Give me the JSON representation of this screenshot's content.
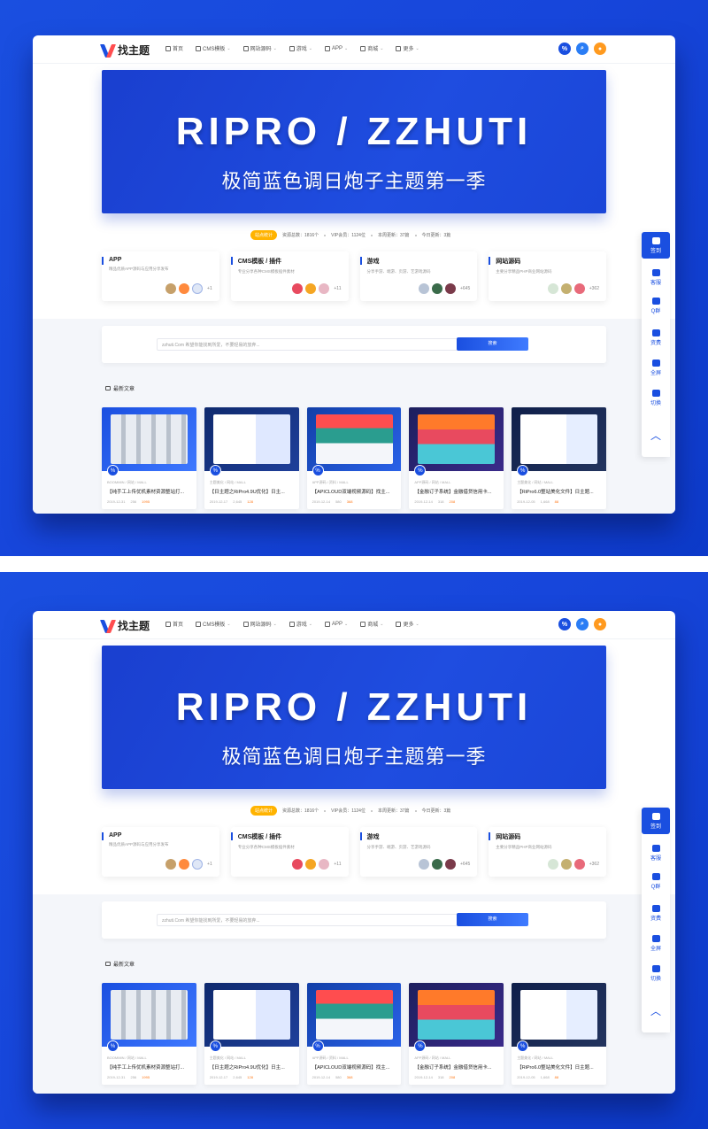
{
  "screens": [
    {
      "nav": {
        "logo": "找主题",
        "menu": [
          "首页",
          "CMS模板",
          "网站源码",
          "游戏",
          "APP",
          "商城",
          "更多"
        ],
        "icons": [
          "percent-icon",
          "search-icon",
          "user-icon"
        ]
      },
      "banner": {
        "title": "RIPRO / ZZHUTI",
        "subtitle": "极简蓝色调日炮子主题第一季"
      },
      "stats": {
        "pill": "站点统计",
        "items": [
          "资源总数：1816个",
          "VIP会员：1124位",
          "本周更新：37篇",
          "今日更新：3篇"
        ]
      },
      "categories": [
        {
          "title": "APP",
          "desc": "精品优质APP源码与应用分享发布",
          "more": "+1"
        },
        {
          "title": "CMS模板 / 插件",
          "desc": "专业分享各种CMS模板插件素材",
          "more": "+11"
        },
        {
          "title": "游戏",
          "desc": "分享手游、端游、页游、艺游戏源码",
          "more": "+645"
        },
        {
          "title": "网站源码",
          "desc": "主要分享精品PHP商业网站源码",
          "more": "+362"
        }
      ],
      "search": {
        "placeholder": "zzhuti.Com 希望你能找到所爱，不要轻易的放弃...",
        "button": "搜索"
      },
      "latest_title": "最新文章",
      "posts": [
        {
          "meta": "BOOMMIN / 网站 / MALL",
          "title": "【纯手工上传优机素材资源整站打...",
          "date": "2019-12-31",
          "comments": "256",
          "views": "1995"
        },
        {
          "meta": "主题美化 / 网站 / MALL",
          "title": "【日主题之RiPro4.9U优化】日主...",
          "date": "2019-12-17",
          "comments": "2,645",
          "views": "128"
        },
        {
          "meta": "APP源码 / 资料 / MALL",
          "title": "【APICLOUD双端视频源码】找主...",
          "date": "2019-12-14",
          "comments": "580",
          "views": "368"
        },
        {
          "meta": "APP源码 / 网站 / MALL",
          "title": "【金融订子系统】金融借贷信用卡...",
          "date": "2019-12-14",
          "comments": "318",
          "views": "208"
        },
        {
          "meta": "主题美化 / 网站 / MALL",
          "title": "【RiPro6.0整站美化文件】日主题...",
          "date": "2019-12-05",
          "comments": "1,668",
          "views": "88"
        }
      ],
      "side": [
        {
          "label": "签到",
          "icon": "calendar-icon"
        },
        {
          "label": "客服",
          "icon": "qq-icon"
        },
        {
          "label": "Q群",
          "icon": "group-icon"
        },
        {
          "label": "资费",
          "icon": "vip-icon"
        },
        {
          "label": "全屏",
          "icon": "fullscreen-icon"
        },
        {
          "label": "切换",
          "icon": "sun-icon"
        }
      ],
      "back_top": "︿"
    }
  ],
  "colors": {
    "brand": "#1a4fe0",
    "accent": "#ff4d4f",
    "warning": "#ffb300",
    "background": "#1746db"
  }
}
